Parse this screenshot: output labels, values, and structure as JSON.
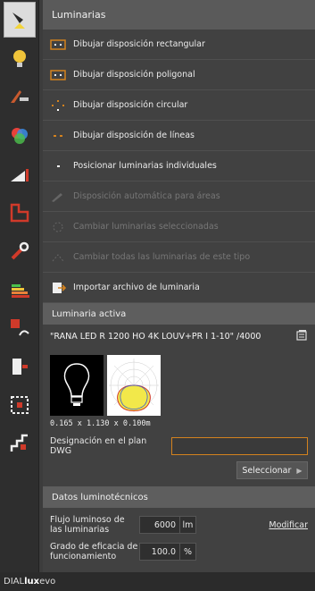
{
  "toolbar": {
    "items": [
      {
        "name": "luminaire-lamp-icon",
        "active": true
      },
      {
        "name": "bulb-icon"
      },
      {
        "name": "scene-light-icon"
      },
      {
        "name": "color-icon"
      },
      {
        "name": "ramp-icon"
      },
      {
        "name": "floorplan-icon"
      },
      {
        "name": "wrench-icon"
      },
      {
        "name": "energy-icon"
      },
      {
        "name": "text-curve-icon"
      },
      {
        "name": "door-icon"
      },
      {
        "name": "frame-icon"
      },
      {
        "name": "stairs-icon"
      }
    ]
  },
  "panel": {
    "title": "Luminarias",
    "actions": [
      {
        "label": "Dibujar disposición rectangular",
        "enabled": true,
        "icon": "rect-layout-icon"
      },
      {
        "label": "Dibujar disposición poligonal",
        "enabled": true,
        "icon": "polygon-layout-icon"
      },
      {
        "label": "Dibujar disposición circular",
        "enabled": true,
        "icon": "circle-layout-icon"
      },
      {
        "label": "Dibujar disposición de líneas",
        "enabled": true,
        "icon": "line-layout-icon"
      },
      {
        "label": "Posicionar luminarias individuales",
        "enabled": true,
        "icon": "single-luminaire-icon"
      },
      {
        "label": "Disposición automática para áreas",
        "enabled": false,
        "icon": "auto-layout-icon"
      },
      {
        "label": "Cambiar luminarias seleccionadas",
        "enabled": false,
        "icon": "change-selected-icon"
      },
      {
        "label": "Cambiar todas las luminarias de este tipo",
        "enabled": false,
        "icon": "change-all-icon"
      },
      {
        "label": "Importar archivo de luminaria",
        "enabled": true,
        "icon": "import-file-icon"
      }
    ]
  },
  "active": {
    "title": "Luminaria activa",
    "name": "\"RANA LED R 1200 HO 4K LOUV+PR I 1-10\" /4000",
    "dims": "0.165 x 1.130 x 0.100m",
    "dwg_label": "Designación en el plan DWG",
    "dwg_value": "",
    "select_label": "Seleccionar"
  },
  "photometric": {
    "title": "Datos luminotécnicos",
    "flux_label": "Flujo luminoso de las luminarias",
    "flux_value": "6000",
    "flux_unit": "lm",
    "modify_label": "Modificar",
    "eff_label": "Grado de eficacia de funcionamiento",
    "eff_value": "100.0",
    "eff_unit": "%"
  },
  "footer": {
    "brand_a": "DIAL",
    "brand_b": "lux",
    "brand_c": " evo"
  },
  "colors": {
    "accent": "#d4821e",
    "panel": "#414141",
    "header": "#5a5a5a"
  }
}
